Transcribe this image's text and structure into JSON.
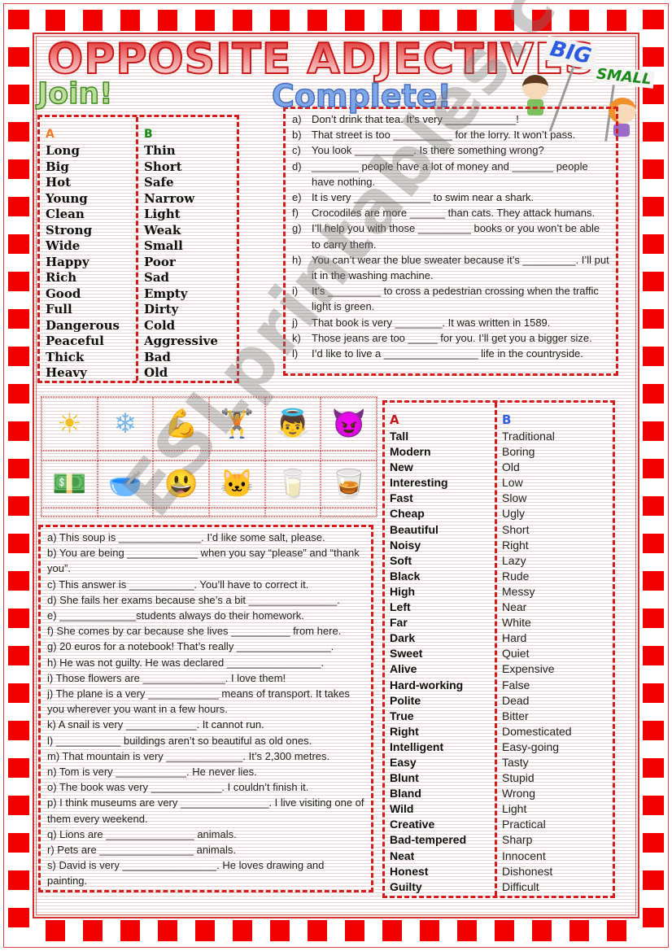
{
  "worksheet": {
    "title": "OPPOSITE ADJECTIVES",
    "join_heading": "Join!",
    "complete_heading": "Complete!",
    "illustration": {
      "sign_big": "BIG",
      "sign_small": "SMALL"
    },
    "watermark": "ESLprintables.com"
  },
  "join_section": {
    "column_a_header": "A",
    "column_b_header": "B",
    "column_a": [
      "Long",
      "Big",
      "Hot",
      "Young",
      "Clean",
      "Strong",
      "Wide",
      "Happy",
      "Rich",
      "Good",
      "Full",
      "Dangerous",
      "Peaceful",
      "Thick",
      "Heavy"
    ],
    "column_b": [
      "Thin",
      "Short",
      "Safe",
      "Narrow",
      "Light",
      "Weak",
      "Small",
      "Poor",
      "Sad",
      "Empty",
      "Dirty",
      "Cold",
      "Aggressive",
      "Bad",
      "Old"
    ]
  },
  "complete_section": {
    "items": [
      {
        "label": "a)",
        "text": "Don’t drink that tea. It’s very ____________!"
      },
      {
        "label": "b)",
        "text": "That street is too __________ for the lorry. It won’t pass."
      },
      {
        "label": "c)",
        "text": "You look __________. Is there something wrong?"
      },
      {
        "label": "d)",
        "text": "________ people have a lot of money and _______ people have nothing."
      },
      {
        "label": "e)",
        "text": "It is very _____________ to swim near a shark."
      },
      {
        "label": "f)",
        "text": "Crocodiles are more ______ than cats. They attack humans."
      },
      {
        "label": "g)",
        "text": "I’ll help you with those _________ books or you won’t be able to carry them."
      },
      {
        "label": "h)",
        "text": "You can’t wear the blue sweater because it’s _________. I’ll put it in the washing machine."
      },
      {
        "label": "i)",
        "text": "It’s _________ to cross a pedestrian crossing when the traffic light is green."
      },
      {
        "label": "j)",
        "text": "That book is very ________. It was written in 1589."
      },
      {
        "label": "k)",
        "text": "Those jeans are too _____ for you. I’ll get you a bigger size."
      },
      {
        "label": "l)",
        "text": "I’d like to live a ________________ life in the countryside."
      }
    ]
  },
  "picture_grid": {
    "pictures": [
      {
        "icon": "sun-thermometer-icon",
        "glyph": "☀",
        "color": "#f0c020"
      },
      {
        "icon": "cold-thermometer-icon",
        "glyph": "❄",
        "color": "#7ab8e8"
      },
      {
        "icon": "strong-man-icon",
        "glyph": "💪",
        "color": "#e8a040"
      },
      {
        "icon": "weightlifter-icon",
        "glyph": "🏋",
        "color": "#888888"
      },
      {
        "icon": "angel-girl-icon",
        "glyph": "👼",
        "color": "#c0505a"
      },
      {
        "icon": "devil-icon",
        "glyph": "😈",
        "color": "#c81818"
      },
      {
        "icon": "money-icon",
        "glyph": "💵",
        "color": "#3a9a30"
      },
      {
        "icon": "poor-man-icon",
        "glyph": "🥣",
        "color": "#8a5a30"
      },
      {
        "icon": "happy-girl-icon",
        "glyph": "😃",
        "color": "#f08020"
      },
      {
        "icon": "sad-cat-icon",
        "glyph": "🐱",
        "color": "#aaaaaa"
      },
      {
        "icon": "full-glass-icon",
        "glyph": "🥛",
        "color": "#5cc8d8"
      },
      {
        "icon": "empty-glass-icon",
        "glyph": "🥃",
        "color": "#a8a8a8"
      }
    ]
  },
  "sentences_section": {
    "items": [
      "a) This soup is ______________. I’d like some salt, please.",
      "b) You are being ____________ when you say “please” and “thank you”.",
      "c) This answer is ___________. You’ll have to correct it.",
      "d) She fails her exams because she’s a bit _______________.",
      "e) _____________students always do their homework.",
      "f) She comes by car because she lives __________ from here.",
      "g) 20 euros for a notebook! That’s really ________________.",
      "h) He was not guilty. He was declared ________________.",
      "i) Those flowers are ______________. I love them!",
      "j) The plane is a very ____________ means of transport. It takes you wherever you want in a few hours.",
      "k) A snail is very ____________. It cannot run.",
      "l) ___________ buildings aren’t so beautiful as old ones.",
      "m) That mountain is very _____________. It’s 2,300 metres.",
      "n) Tom is very ____________. He never lies.",
      "o) The book was very ____________. I couldn’t finish it.",
      "p) I think museums are very _______________. I live visiting one of them every weekend.",
      "q) Lions are _______________ animals.",
      "r) Pets are ________________ animals.",
      "s) David is very ________________. He loves drawing and painting."
    ]
  },
  "match_section": {
    "column_a_header": "A",
    "column_b_header": "B",
    "column_a": [
      "Tall",
      "Modern",
      "New",
      "Interesting",
      "Fast",
      "Cheap",
      "Beautiful",
      "Noisy",
      "Soft",
      "Black",
      "High",
      "Left",
      "Far",
      "Dark",
      "Sweet",
      "Alive",
      "Hard-working",
      "Polite",
      "True",
      "Right",
      "Intelligent",
      "Easy",
      "Blunt",
      "Bland",
      "Wild",
      "Creative",
      "Bad-tempered",
      "Neat",
      "Honest",
      "Guilty"
    ],
    "column_b": [
      "Traditional",
      "Boring",
      "Old",
      "Low",
      "Slow",
      "Ugly",
      "Short",
      "Right",
      "Lazy",
      "Rude",
      "Messy",
      "Near",
      "White",
      "Hard",
      "Quiet",
      "Expensive",
      "False",
      "Dead",
      "Bitter",
      "Domesticated",
      "Easy-going",
      "Tasty",
      "Stupid",
      "Wrong",
      "Light",
      "Practical",
      "Sharp",
      "Innocent",
      "Dishonest",
      "Difficult"
    ]
  },
  "colors": {
    "border_red": "#f20000",
    "dash_red": "#d41c1c",
    "join_green": "#bedc9c",
    "complete_blue": "#7ea7e8",
    "header_orange": "#ef7a1e",
    "header_green": "#128a12",
    "header_red": "#c01818",
    "header_blue": "#2f5fe0"
  }
}
